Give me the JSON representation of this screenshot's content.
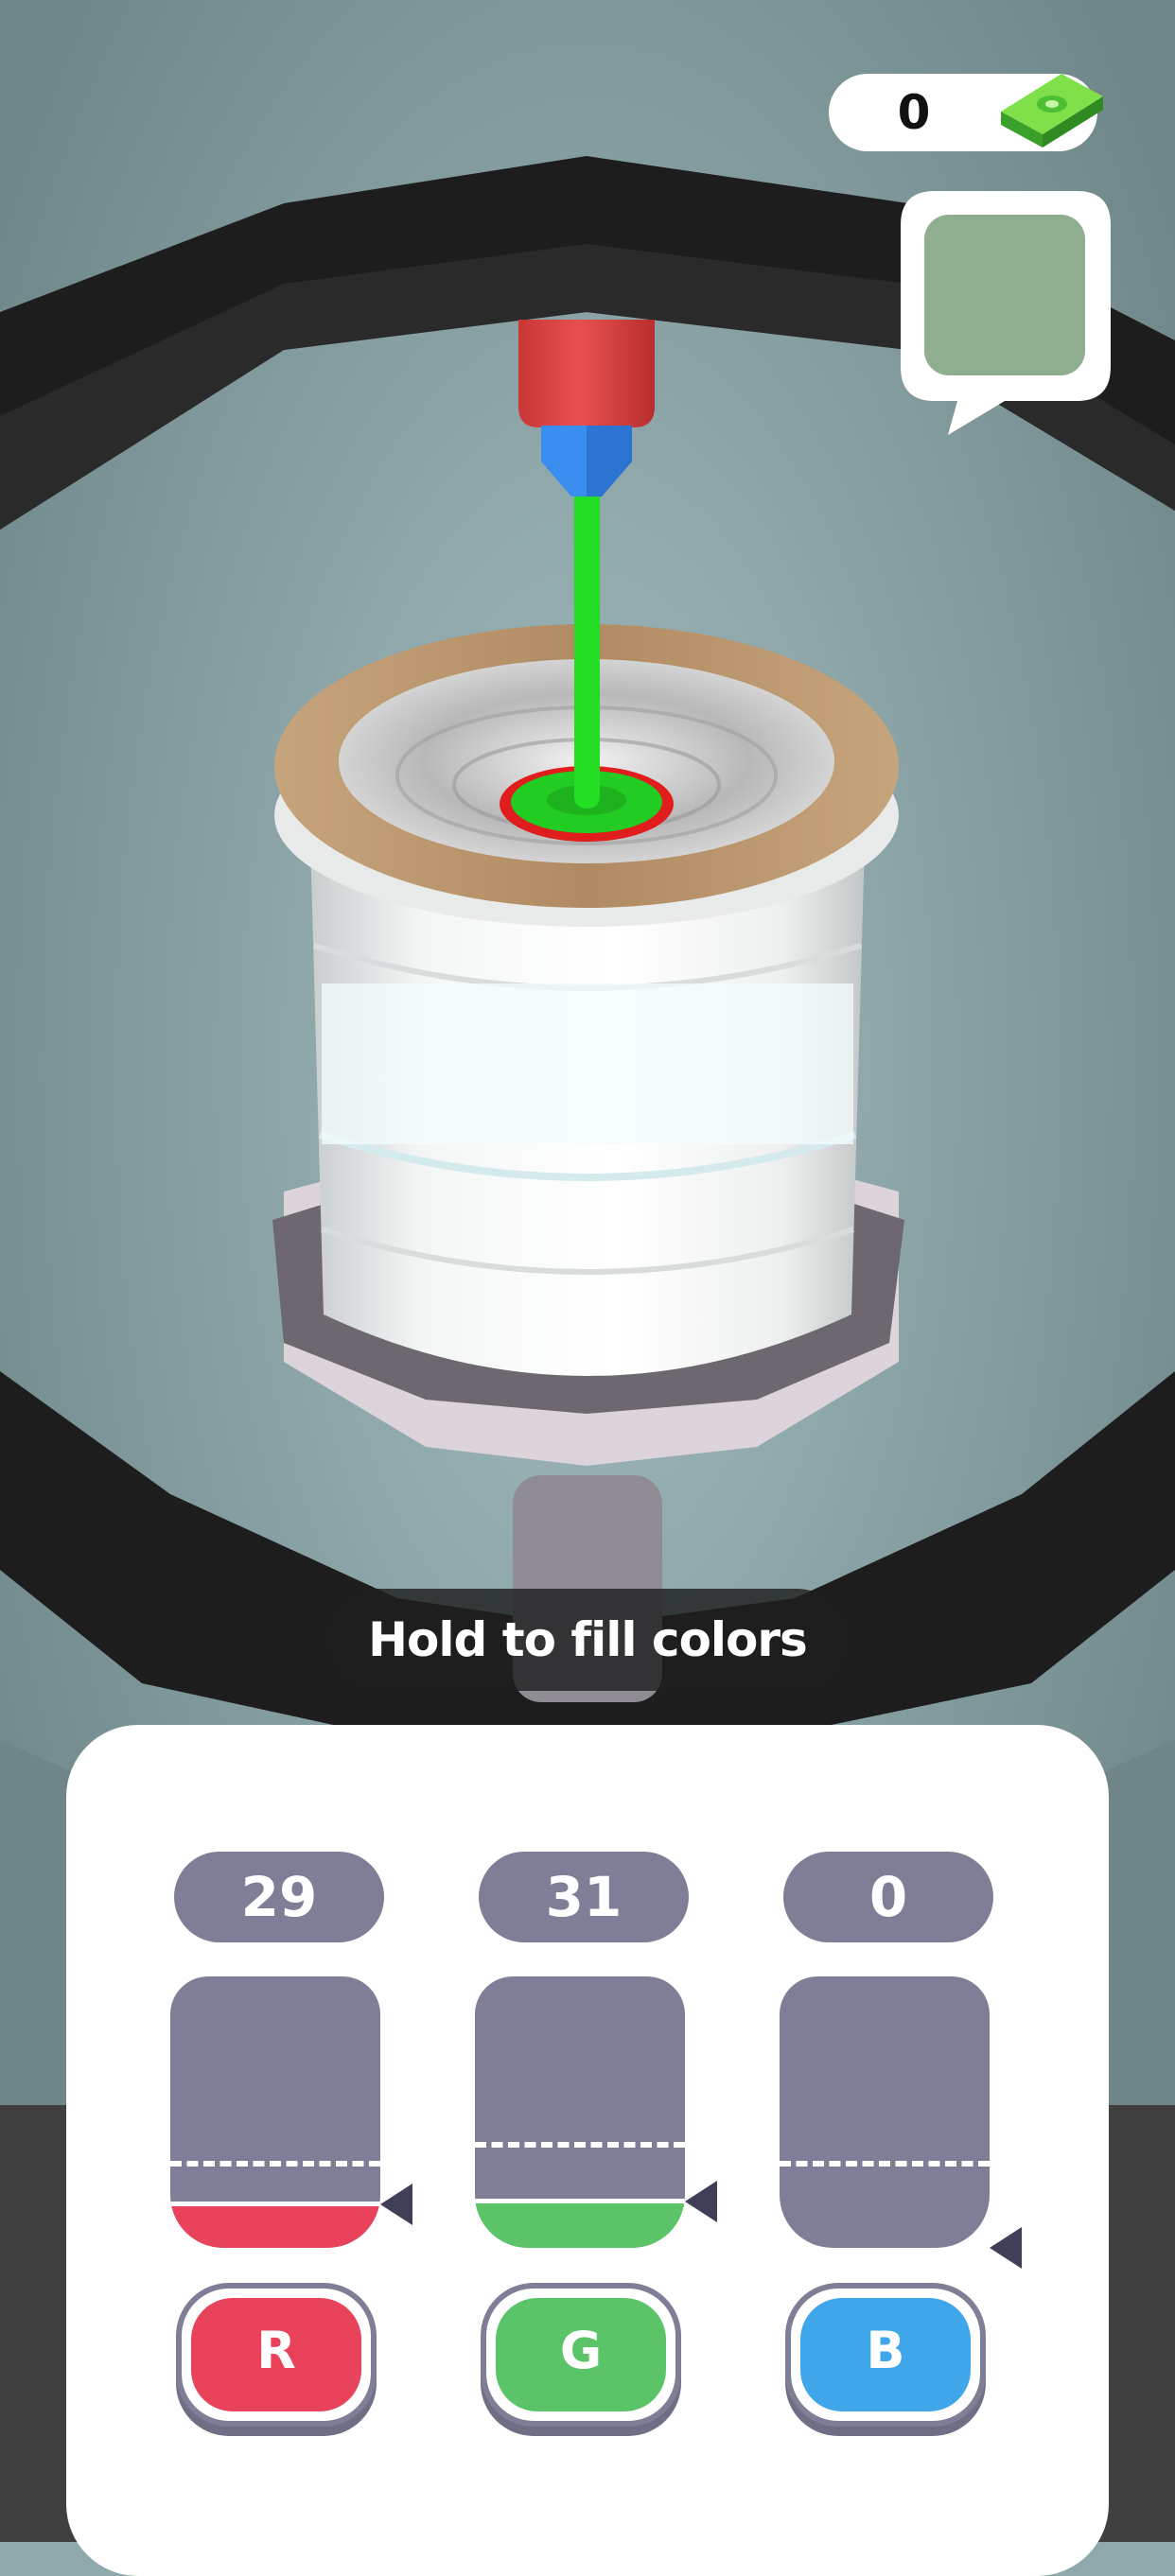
{
  "hud": {
    "money": "0",
    "cash_icon": "cash-stack-icon",
    "target_color": "#8fae8f"
  },
  "hint": "Hold to fill colors",
  "channels": [
    {
      "key": "r",
      "label": "R",
      "count": "29",
      "fill_level": 0.17,
      "target_level": 0.32,
      "color": "#e8435a",
      "marker_level": 0.16
    },
    {
      "key": "g",
      "label": "G",
      "count": "31",
      "fill_level": 0.18,
      "target_level": 0.39,
      "color": "#5cc468",
      "marker_level": 0.17
    },
    {
      "key": "b",
      "label": "B",
      "count": "0",
      "fill_level": 0.0,
      "target_level": 0.32,
      "color": "#3fa6ea",
      "marker_level": 0.0
    }
  ],
  "colors": {
    "background": "#8fa8ab",
    "ring": "#1d1d1d",
    "paint_stream": "#22dd22",
    "nozzle_body": "#e04848",
    "nozzle_tip": "#3a8ef0",
    "panel": "#ffffff",
    "tank": "#7e7f96"
  }
}
